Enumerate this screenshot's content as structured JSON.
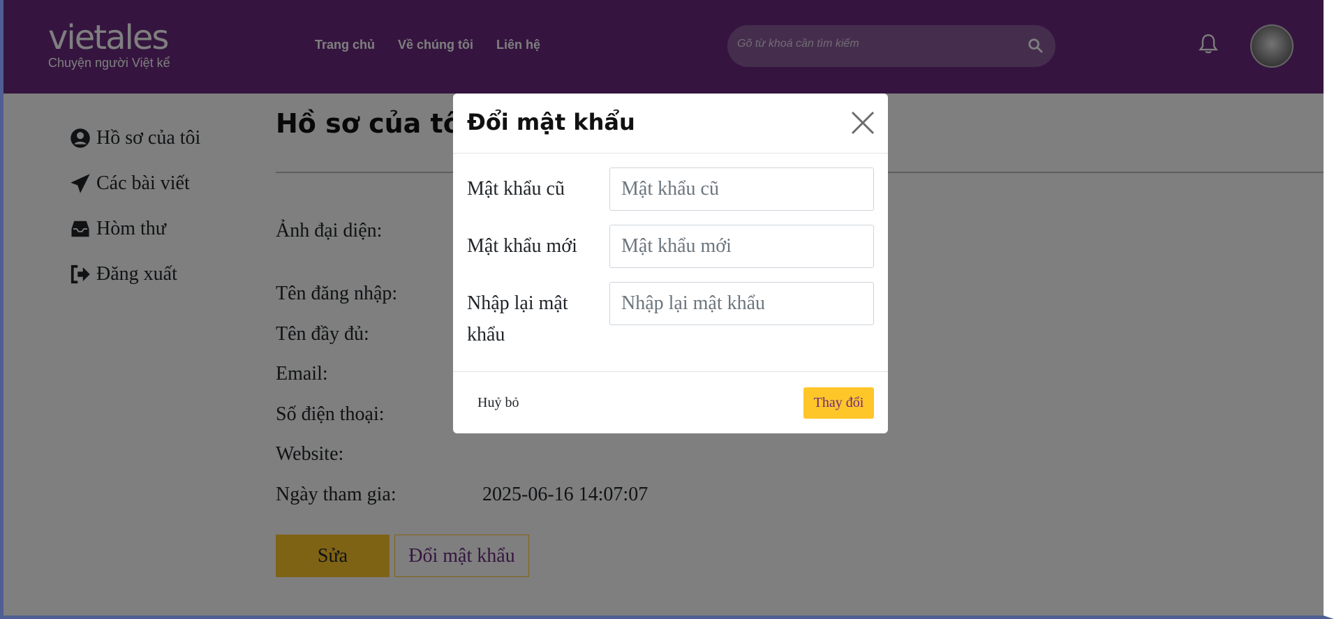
{
  "header": {
    "logo_word": "vietales",
    "logo_tagline": "Chuyện người Việt kể",
    "nav": [
      "Trang chủ",
      "Về chúng tôi",
      "Liên hệ"
    ],
    "search_placeholder": "Gõ từ khoá cần tìm kiếm"
  },
  "sidebar": {
    "items": [
      {
        "label": "Hồ sơ của tôi",
        "icon": "user-circle-icon"
      },
      {
        "label": "Các bài viết",
        "icon": "paper-plane-icon"
      },
      {
        "label": "Hòm thư",
        "icon": "inbox-icon"
      },
      {
        "label": "Đăng xuất",
        "icon": "sign-out-icon"
      }
    ]
  },
  "profile": {
    "title": "Hồ sơ của tôi",
    "fields": [
      {
        "label": "Ảnh đại diện:",
        "value": ""
      },
      {
        "label": "Tên đăng nhập:",
        "value": ""
      },
      {
        "label": "Tên đầy đủ:",
        "value": ""
      },
      {
        "label": "Email:",
        "value": ""
      },
      {
        "label": "Số điện thoại:",
        "value": ""
      },
      {
        "label": "Website:",
        "value": ""
      },
      {
        "label": "Ngày tham gia:",
        "value": "2025-06-16 14:07:07"
      }
    ],
    "edit_label": "Sửa",
    "change_password_label": "Đổi mật khẩu"
  },
  "modal": {
    "title": "Đổi mật khẩu",
    "fields": [
      {
        "label": "Mật khẩu cũ",
        "placeholder": "Mật khẩu cũ",
        "value": ""
      },
      {
        "label": "Mật khẩu mới",
        "placeholder": "Mật khẩu mới",
        "value": ""
      },
      {
        "label": "Nhập lại mật khẩu",
        "placeholder": "Nhập lại mật khẩu",
        "value": ""
      }
    ],
    "cancel_label": "Huỷ bỏ",
    "submit_label": "Thay đổi"
  },
  "colors": {
    "brand_purple": "#6b2a7f",
    "accent_yellow": "#ffc629",
    "logo_dot": "#f5a623"
  }
}
